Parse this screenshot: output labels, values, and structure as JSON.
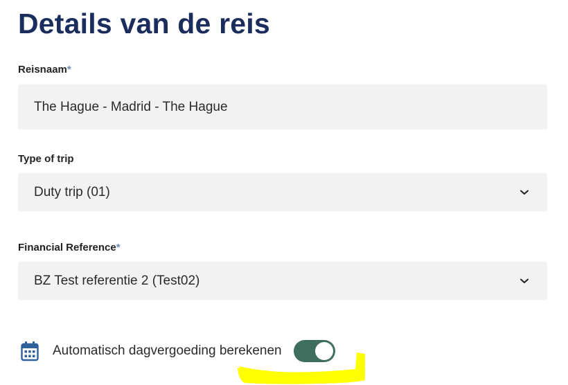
{
  "page": {
    "title": "Details van de reis"
  },
  "fields": {
    "trip_name": {
      "label": "Reisnaam",
      "required_mark": "*",
      "value": "The Hague - Madrid - The Hague"
    },
    "trip_type": {
      "label": "Type of trip",
      "value": "Duty trip (01)"
    },
    "financial_reference": {
      "label": "Financial Reference",
      "required_mark": "*",
      "value": "BZ Test referentie 2 (Test02)"
    }
  },
  "auto_allowance": {
    "label": "Automatisch dagvergoeding berekenen",
    "enabled": true
  },
  "icons": {
    "calendar": "calendar-icon",
    "chevron": "chevron-down-icon"
  },
  "colors": {
    "title": "#1b2d5c",
    "required": "#6a8fb6",
    "field_bg": "#f2f2f2",
    "toggle_on": "#3e6e5e",
    "calendar_icon": "#2f5f9a",
    "highlight": "#ffff00"
  }
}
